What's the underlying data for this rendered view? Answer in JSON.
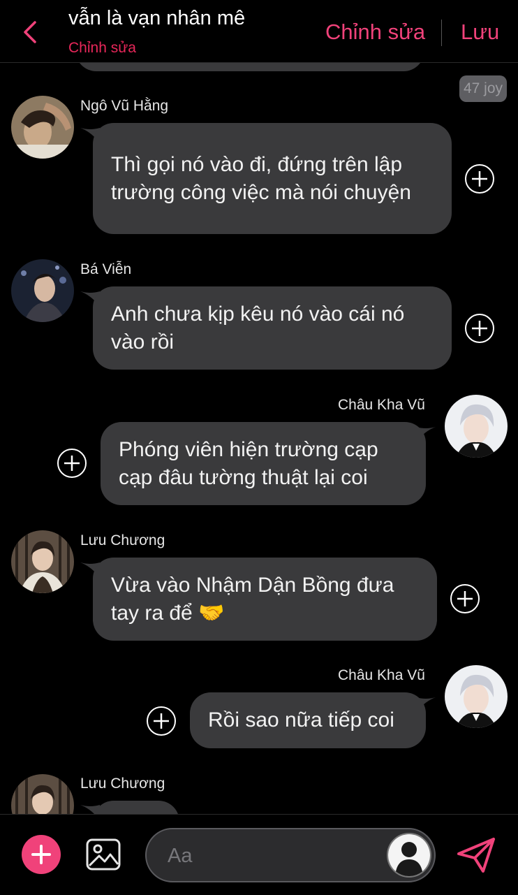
{
  "header": {
    "title": "vẫn là vạn nhân mê",
    "subtitle": "Chỉnh sửa",
    "edit_label": "Chỉnh sửa",
    "save_label": "Lưu"
  },
  "badge": "47 joy",
  "messages": [
    {
      "side": "left",
      "sender": "Ngô Vũ Hằng",
      "text": "Thì gọi nó vào đi, đứng trên lập trường công việc mà nói chuyện",
      "avatar_icon": "avatar-photo"
    },
    {
      "side": "left",
      "sender": "Bá Viễn",
      "text": "Anh chưa kịp kêu nó vào cái nó vào rồi",
      "avatar_icon": "avatar-photo"
    },
    {
      "side": "right",
      "sender": "Châu Kha Vũ",
      "text": "Phóng viên hiện trường cạp cạp đâu tường thuật lại coi",
      "avatar_icon": "avatar-photo"
    },
    {
      "side": "left",
      "sender": "Lưu Chương",
      "text": "Vừa vào Nhậm Dận Bồng đưa tay ra để 🤝",
      "avatar_icon": "avatar-photo"
    },
    {
      "side": "right",
      "sender": "Châu Kha Vũ",
      "text": "Rồi sao nữa tiếp coi",
      "avatar_icon": "avatar-photo"
    },
    {
      "side": "left",
      "sender": "Lưu Chương",
      "text": "",
      "avatar_icon": "avatar-photo"
    }
  ],
  "composer": {
    "placeholder": "Aa"
  },
  "colors": {
    "accent": "#f0427a",
    "accent_dark": "#e8275a",
    "bubble": "#3a3a3c",
    "background": "#000000"
  }
}
